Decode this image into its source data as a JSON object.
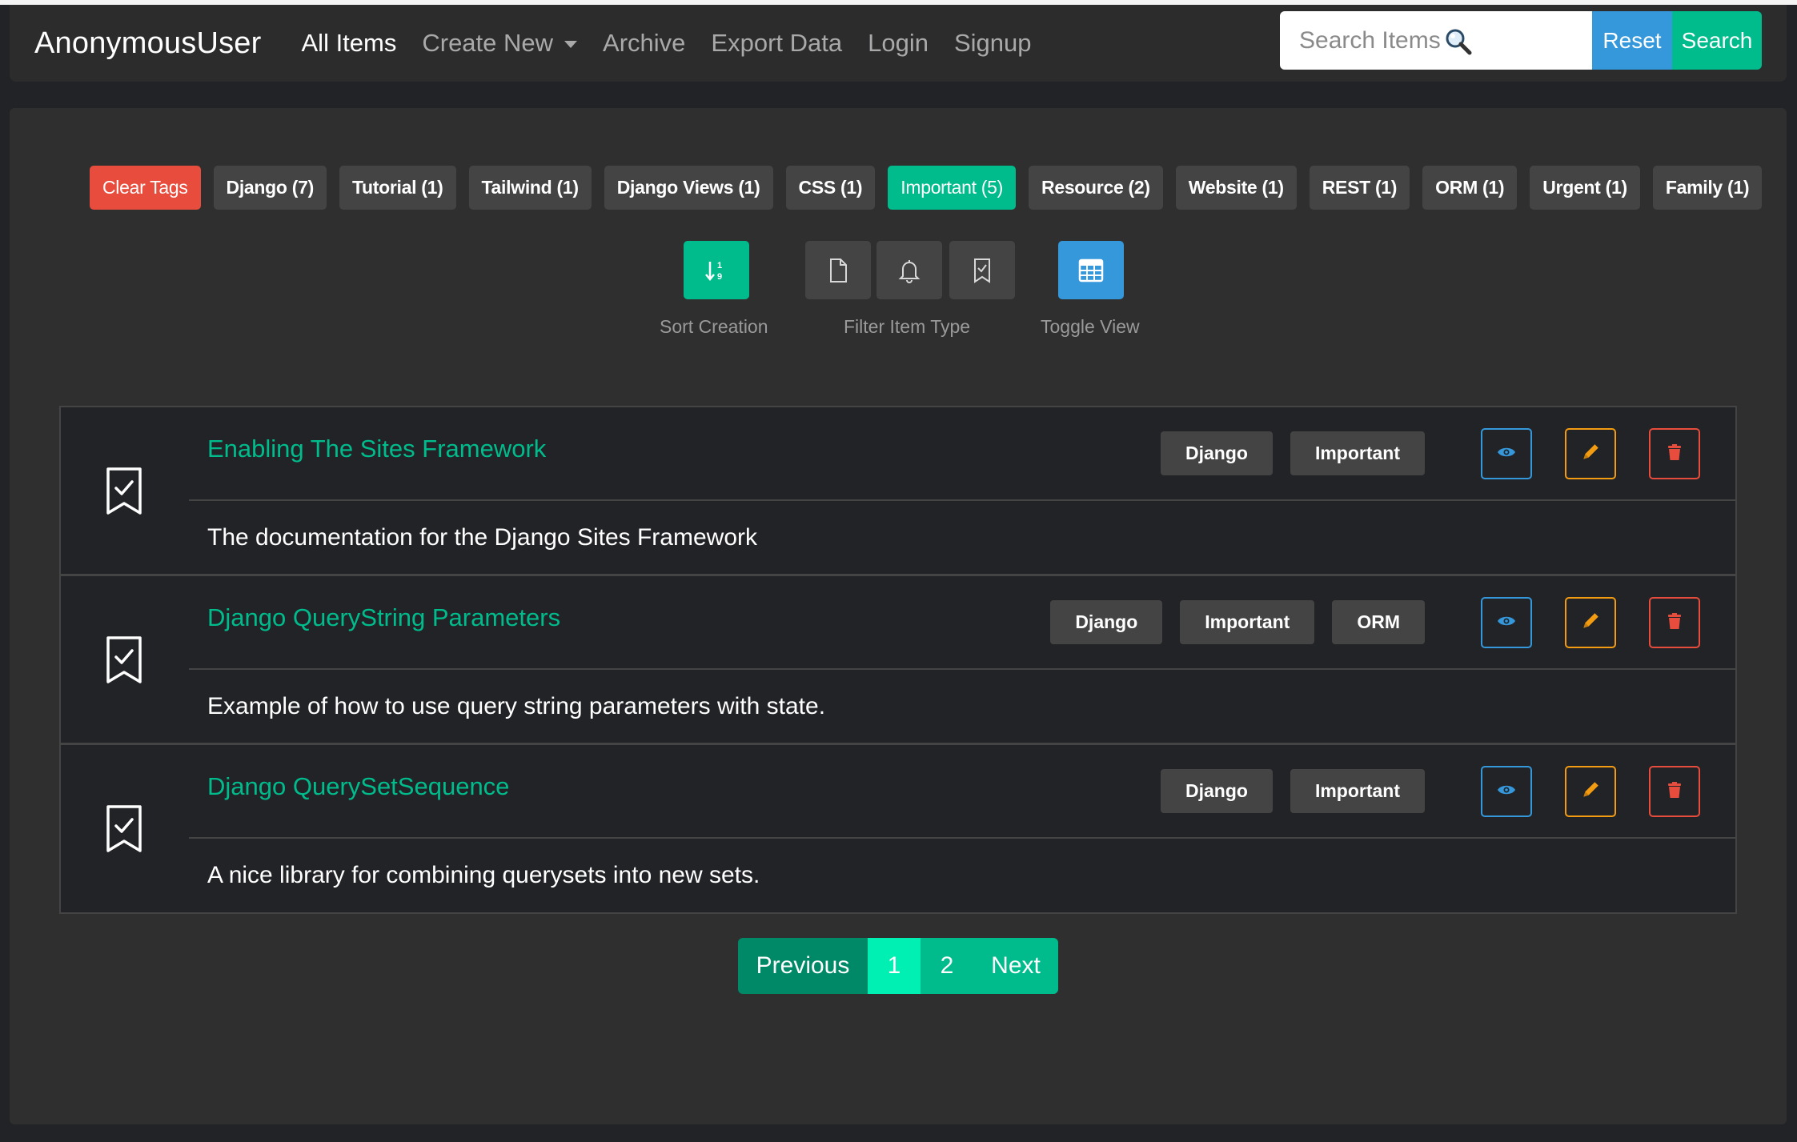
{
  "navbar": {
    "brand": "AnonymousUser",
    "links": {
      "all_items": "All Items",
      "create_new": "Create New",
      "archive": "Archive",
      "export_data": "Export Data",
      "login": "Login",
      "signup": "Signup"
    },
    "search": {
      "placeholder": "Search Items",
      "value": "",
      "reset_label": "Reset",
      "search_label": "Search"
    }
  },
  "tags": [
    {
      "label": "Clear Tags",
      "style": "danger"
    },
    {
      "label": "Django (7)",
      "style": "default"
    },
    {
      "label": "Tutorial (1)",
      "style": "default"
    },
    {
      "label": "Tailwind (1)",
      "style": "default"
    },
    {
      "label": "Django Views (1)",
      "style": "default"
    },
    {
      "label": "CSS (1)",
      "style": "default"
    },
    {
      "label": "Important (5)",
      "style": "success"
    },
    {
      "label": "Resource (2)",
      "style": "default"
    },
    {
      "label": "Website (1)",
      "style": "default"
    },
    {
      "label": "REST (1)",
      "style": "default"
    },
    {
      "label": "ORM (1)",
      "style": "default"
    },
    {
      "label": "Urgent (1)",
      "style": "default"
    },
    {
      "label": "Family (1)",
      "style": "default"
    }
  ],
  "controls": {
    "sort_label": "Sort Creation",
    "filter_label": "Filter Item Type",
    "toggle_label": "Toggle View",
    "sort_icon_text": "1 9"
  },
  "items": [
    {
      "title": "Enabling The Sites Framework",
      "description": "The documentation for the Django Sites Framework",
      "tags": [
        "Django",
        "Important"
      ]
    },
    {
      "title": "Django QueryString Parameters",
      "description": "Example of how to use query string parameters with state.",
      "tags": [
        "Django",
        "Important",
        "ORM"
      ]
    },
    {
      "title": "Django QuerySetSequence",
      "description": "A nice library for combining querysets into new sets.",
      "tags": [
        "Django",
        "Important"
      ]
    }
  ],
  "pagination": {
    "previous": "Previous",
    "pages": [
      "1",
      "2"
    ],
    "current": "1",
    "next": "Next"
  },
  "colors": {
    "accent_green": "#00bc8c",
    "accent_blue": "#3498db",
    "danger_red": "#e74c3c",
    "warning_orange": "#f39c12",
    "background": "#222326",
    "panel": "#2f2f30"
  }
}
